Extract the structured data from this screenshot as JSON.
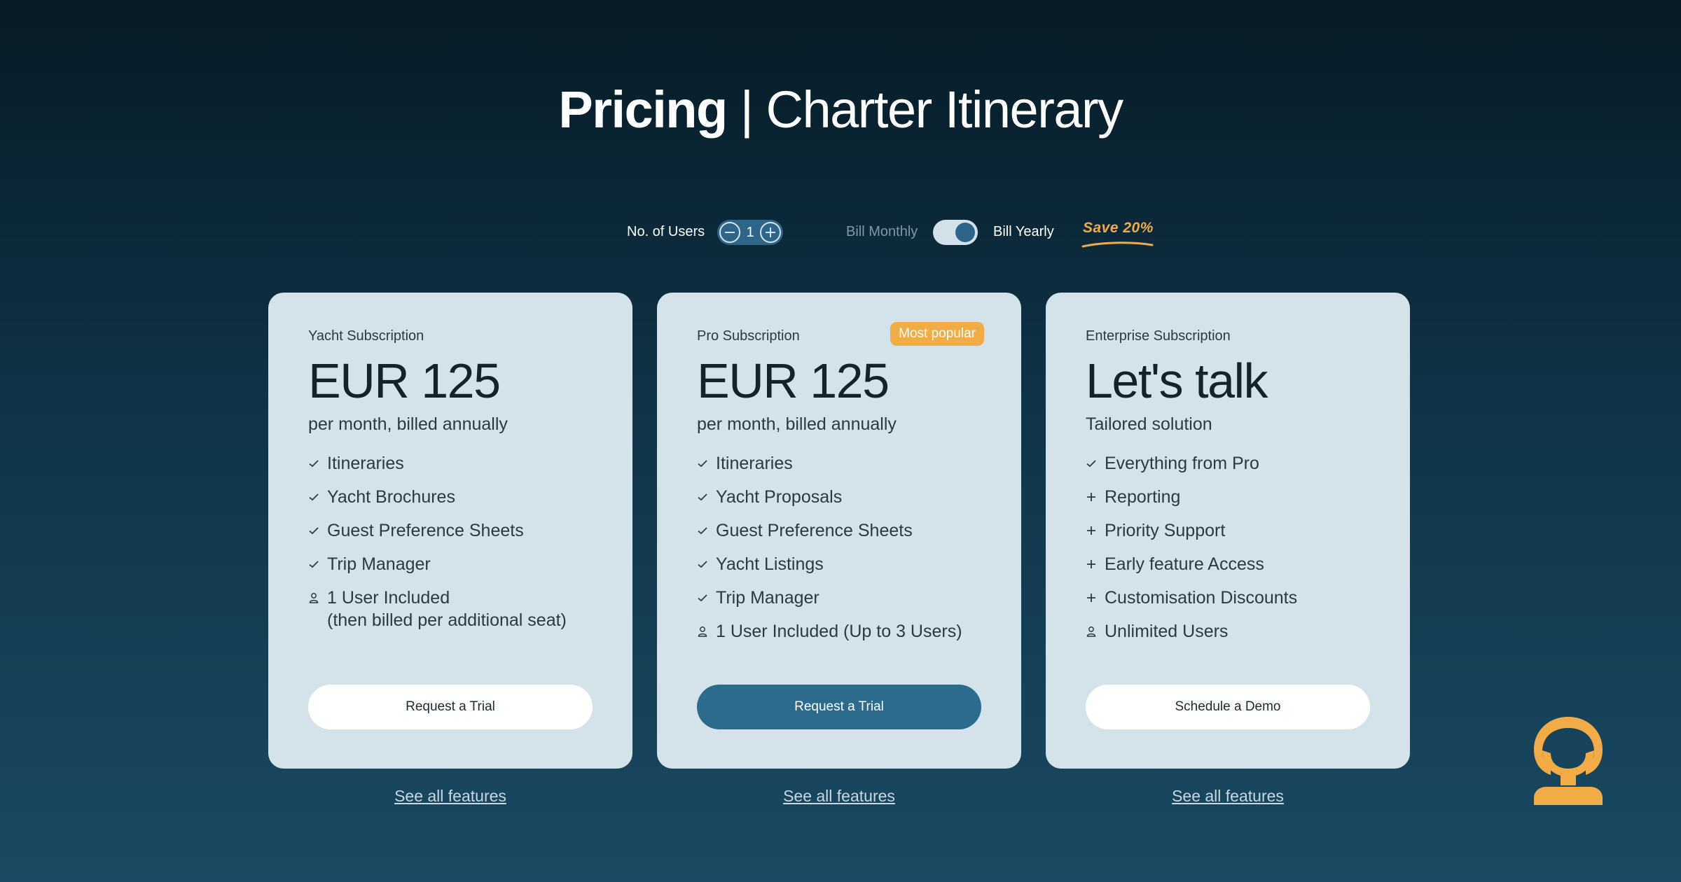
{
  "header": {
    "title_bold": "Pricing",
    "title_rest": " | Charter Itinerary"
  },
  "controls": {
    "users_label": "No. of Users",
    "users_value": "1",
    "bill_monthly": "Bill Monthly",
    "bill_yearly": "Bill Yearly",
    "billing_selected": "yearly",
    "save_label": "Save 20%"
  },
  "plans": [
    {
      "name": "Yacht Subscription",
      "price": "EUR 125",
      "period": "per month, billed annually",
      "features": [
        {
          "icon": "check-icon",
          "text": "Itineraries"
        },
        {
          "icon": "check-icon",
          "text": "Yacht Brochures"
        },
        {
          "icon": "check-icon",
          "text": "Guest Preference Sheets"
        },
        {
          "icon": "check-icon",
          "text": "Trip Manager"
        },
        {
          "icon": "user-icon",
          "text": "1 User Included",
          "text2": "(then billed per additional seat)"
        }
      ],
      "cta": "Request a Trial",
      "see_all": "See all features"
    },
    {
      "name": "Pro Subscription",
      "badge": "Most popular",
      "price": "EUR 125",
      "period": "per month, billed annually",
      "features": [
        {
          "icon": "check-icon",
          "text": "Itineraries"
        },
        {
          "icon": "check-icon",
          "text": "Yacht Proposals"
        },
        {
          "icon": "check-icon",
          "text": "Guest Preference Sheets"
        },
        {
          "icon": "check-icon",
          "text": "Yacht Listings"
        },
        {
          "icon": "check-icon",
          "text": "Trip Manager"
        },
        {
          "icon": "user-icon",
          "text": "1 User Included (Up to 3 Users)"
        }
      ],
      "cta": "Request a Trial",
      "see_all": "See all features"
    },
    {
      "name": "Enterprise Subscription",
      "price": "Let's talk",
      "period": "Tailored solution",
      "features": [
        {
          "icon": "check-icon",
          "text": "Everything from Pro"
        },
        {
          "icon": "plus-icon",
          "text": "Reporting"
        },
        {
          "icon": "plus-icon",
          "text": "Priority Support"
        },
        {
          "icon": "plus-icon",
          "text": "Early feature Access"
        },
        {
          "icon": "plus-icon",
          "text": "Customisation Discounts"
        },
        {
          "icon": "user-icon",
          "text": "Unlimited Users"
        }
      ],
      "cta": "Schedule a Demo",
      "see_all": "See all features"
    }
  ],
  "colors": {
    "accent_orange": "#f2ac45",
    "primary_blue": "#2d6b8d",
    "card_bg": "#d4e3ea"
  },
  "logo": {
    "icon": "brand-logo-icon"
  }
}
